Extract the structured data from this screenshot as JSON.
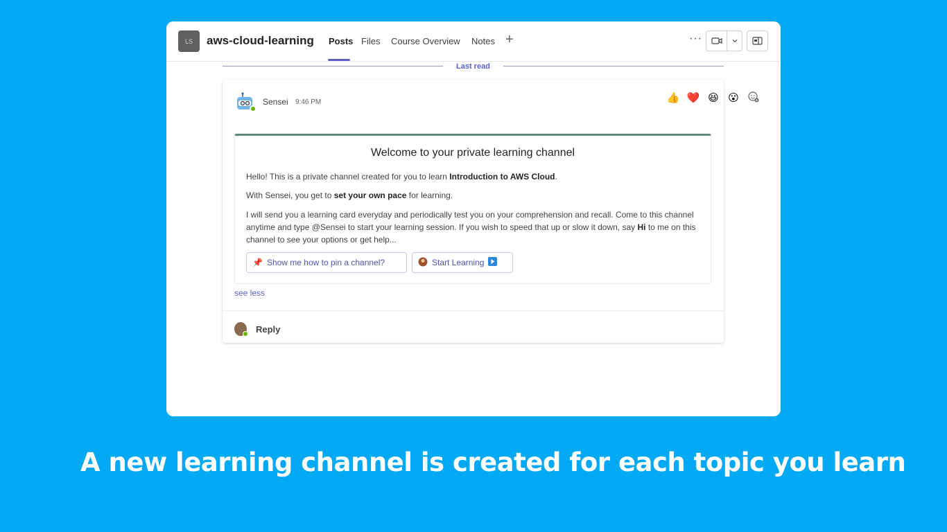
{
  "header": {
    "avatar_initials": "LS",
    "channel_name": "aws-cloud-learning",
    "tabs": [
      {
        "label": "Posts",
        "active": true
      },
      {
        "label": "Files",
        "active": false
      },
      {
        "label": "Course Overview",
        "active": false
      },
      {
        "label": "Notes",
        "active": false
      }
    ],
    "add_tab_icon": "plus-icon",
    "more_icon": "ellipsis-icon",
    "meet_icon": "video-camera-icon",
    "panel_icon": "side-panel-icon"
  },
  "feed": {
    "last_read_label": "Last read"
  },
  "post": {
    "sender": "Sensei",
    "time": "9:46 PM",
    "reactions": [
      "👍",
      "❤️",
      "😆",
      "😮"
    ],
    "reaction_add_icon": "add-reaction-icon",
    "card": {
      "title": "Welcome to your private learning channel",
      "line1_prefix": "Hello! This is a private channel created for you to learn ",
      "line1_bold": "Introduction to AWS Cloud",
      "line1_suffix": ".",
      "line2_prefix": "With Sensei, you get to ",
      "line2_bold": "set your own pace",
      "line2_suffix": " for learning.",
      "line3_part1": "I will send you a learning card everyday and periodically test you on your comprehension and recall. Come to this channel anytime and type @Sensei to start your learning session. If you wish to speed that up or slow it down, say ",
      "line3_bold": "Hi",
      "line3_part2": " to me on this channel to see your options or get help...",
      "button_pin": "Show me how to pin a channel?",
      "button_start": "Start Learning"
    },
    "see_less": "see less",
    "reply_label": "Reply"
  },
  "caption": "A new learning channel is created for each topic you learn",
  "colors": {
    "background": "#04a9f4",
    "accent": "#5b5fc7",
    "card_border": "#5b8b81"
  }
}
